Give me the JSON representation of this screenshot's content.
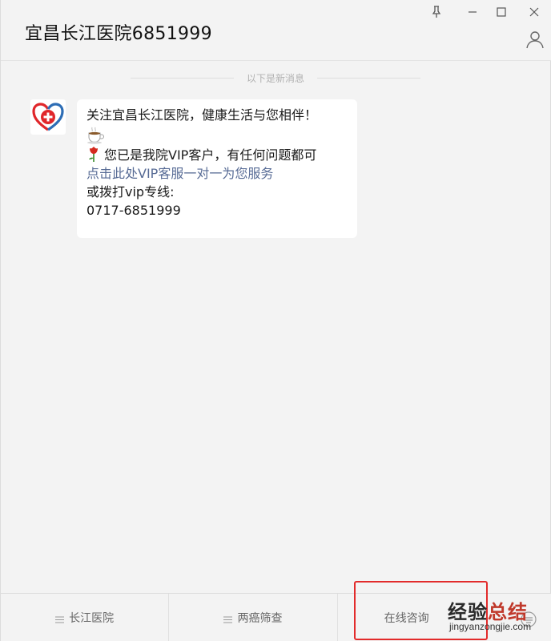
{
  "window": {
    "title": "宜昌长江医院6851999"
  },
  "chat": {
    "new_messages_label": "以下是新消息",
    "message": {
      "line1": "关注宜昌长江医院，健康生活与您相伴！",
      "emoji_coffee": "☕",
      "line2": "您已是我院VIP客户，有任何问题都可",
      "link": "点击此处VIP客服一对一为您服务",
      "line3": "或拨打vip专线:",
      "phone": "0717-6851999"
    }
  },
  "bottom_menu": {
    "items": [
      {
        "label": "长江医院"
      },
      {
        "label": "两癌筛查"
      },
      {
        "label": "在线咨询"
      }
    ]
  },
  "watermark": {
    "main_a": "经验",
    "main_b": "总结",
    "sub": "jingyanzongjie.com"
  },
  "colors": {
    "background": "#f3f3f3",
    "bubble": "#ffffff",
    "link": "#576b95",
    "highlight": "#e22b2b",
    "logo_red": "#e0262a",
    "logo_blue": "#2d6db5"
  },
  "icons": [
    "pin-icon",
    "minimize-icon",
    "maximize-icon",
    "close-icon",
    "profile-icon",
    "menu-icon",
    "keyboard-icon",
    "rose-icon",
    "coffee-icon",
    "hospital-logo"
  ]
}
